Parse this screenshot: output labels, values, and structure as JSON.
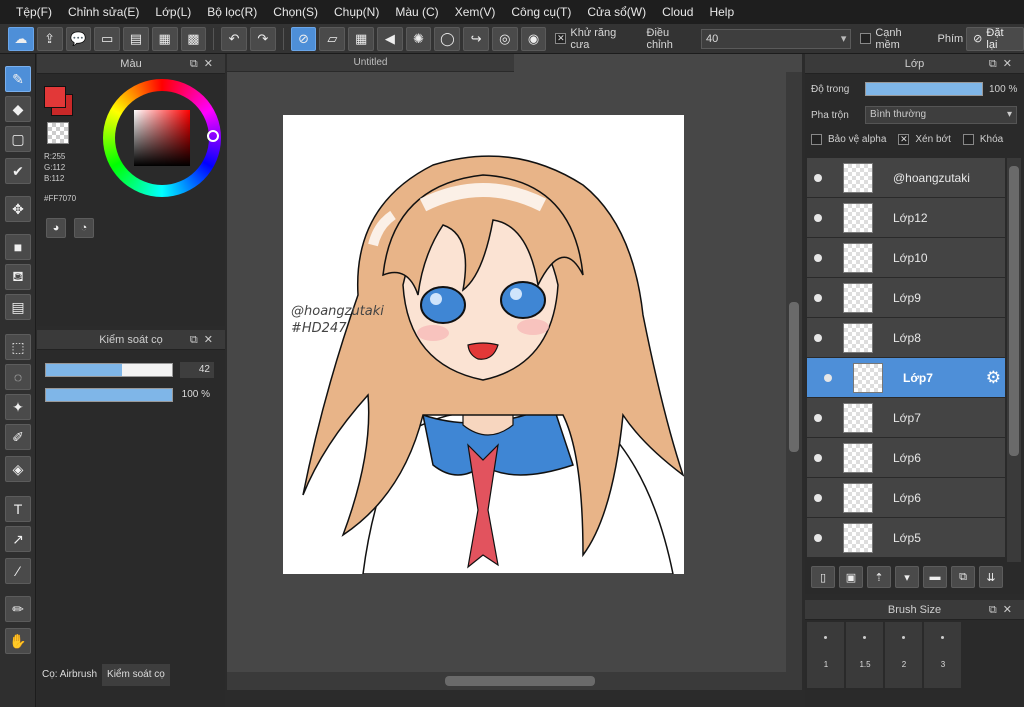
{
  "menu": [
    "Tệp(F)",
    "Chỉnh sửa(E)",
    "Lớp(L)",
    "Bộ lọc(R)",
    "Chọn(S)",
    "Chụp(N)",
    "Màu (C)",
    "Xem(V)",
    "Công cụ(T)",
    "Cửa sổ(W)",
    "Cloud",
    "Help"
  ],
  "toolbar": {
    "antialias_label": "Khử răng cưa",
    "adjust_label": "Điều chỉnh",
    "adjust_value": "40",
    "edge_label": "Cạnh mềm",
    "key_label": "Phím",
    "reset_label": "Đặt lại"
  },
  "color_panel": {
    "title": "Màu",
    "r": "R:255",
    "g": "G:112",
    "b": "B:112",
    "hex": "#FF7070",
    "fg_color": "#e23838"
  },
  "brush_panel": {
    "title": "Kiểm soát cọ",
    "size_value": "42",
    "size_fill": 0.6,
    "opacity_value": "100 %",
    "opacity_fill": 1.0,
    "tab_brush": "Cọ: Airbrush",
    "tab_control": "Kiểm soát cọ"
  },
  "canvas": {
    "doc_title": "Untitled",
    "watermark_line1": "@hoangzutaki",
    "watermark_line2": "#HD247"
  },
  "layer_panel": {
    "title": "Lớp",
    "opacity_label": "Độ trong",
    "opacity_value": "100 %",
    "blend_label": "Pha trộn",
    "blend_value": "Bình thường",
    "protect_alpha": "Bảo vệ alpha",
    "clipping": "Xén bớt",
    "lock": "Khóa",
    "layers": [
      {
        "name": "@hoangzutaki",
        "selected": false
      },
      {
        "name": "Lớp12",
        "selected": false
      },
      {
        "name": "Lớp10",
        "selected": false
      },
      {
        "name": "Lớp9",
        "selected": false
      },
      {
        "name": "Lớp8",
        "selected": false
      },
      {
        "name": "Lớp7",
        "selected": true
      },
      {
        "name": "Lớp7",
        "selected": false
      },
      {
        "name": "Lớp6",
        "selected": false
      },
      {
        "name": "Lớp6",
        "selected": false
      },
      {
        "name": "Lớp5",
        "selected": false
      }
    ]
  },
  "brush_size_panel": {
    "title": "Brush Size",
    "sizes": [
      "1",
      "1.5",
      "2",
      "3"
    ]
  },
  "accent": "#4e8fd8"
}
